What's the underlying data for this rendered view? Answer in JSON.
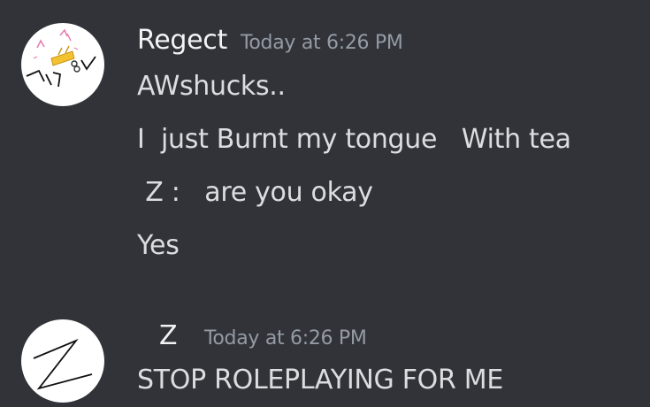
{
  "messages": [
    {
      "author": "Regect",
      "timestamp": "Today at 6:26 PM",
      "avatar_icon": "cat-with-crown-drawing",
      "lines": [
        "AWshucks..",
        "I  just Burnt my tongue   With tea",
        " Z :   are you okay",
        "Yes"
      ]
    },
    {
      "author": "Z",
      "timestamp": "Today at 6:26 PM",
      "avatar_icon": "letter-z-drawing",
      "lines": [
        "STOP ROLEPLAYING FOR ME"
      ]
    }
  ],
  "colors": {
    "background": "#313338",
    "author_text": "#f2f3f5",
    "timestamp_text": "#949ba4",
    "message_text": "#dbdee1"
  }
}
